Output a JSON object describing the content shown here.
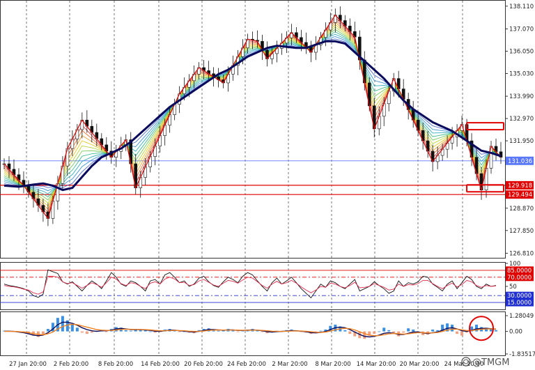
{
  "chart_data": [
    {
      "type": "candlestick",
      "title": "",
      "x": [
        "27 Jan 20:00",
        "2 Feb 20:00",
        "8 Feb 20:00",
        "14 Feb 20:00",
        "20 Feb 20:00",
        "24 Feb 20:00",
        "2 Mar 20:00",
        "8 Mar 20:00",
        "14 Mar 20:00",
        "20 Mar 20:00",
        "24 Mar 20:00"
      ],
      "y_ticks": [
        "138.110",
        "137.070",
        "136.050",
        "135.030",
        "133.990",
        "132.970",
        "131.950",
        "129.918",
        "129.494",
        "128.870",
        "127.850",
        "126.810"
      ],
      "ylim": [
        126.6,
        138.2
      ],
      "current_price": "131.036",
      "levels": [
        {
          "label": "129.918",
          "value": 129.918,
          "color": "#e00000"
        },
        {
          "label": "129.494",
          "value": 129.494,
          "color": "#e00000"
        },
        {
          "label": "131.036",
          "value": 131.036,
          "color": "#5a78ff"
        }
      ],
      "series": [
        {
          "name": "",
          "color": "#0a0a5c",
          "values": [
            [
              0,
              129.9
            ],
            [
              3,
              129.85
            ],
            [
              6,
              129.95
            ],
            [
              8,
              130.0
            ],
            [
              10,
              129.9
            ],
            [
              12,
              129.7
            ],
            [
              14,
              129.8
            ],
            [
              16,
              130.3
            ],
            [
              18,
              130.8
            ],
            [
              20,
              131.2
            ],
            [
              22,
              131.4
            ],
            [
              24,
              131.6
            ],
            [
              26,
              131.9
            ],
            [
              28,
              132.3
            ],
            [
              30,
              132.7
            ],
            [
              32,
              133.1
            ],
            [
              34,
              133.5
            ],
            [
              36,
              133.8
            ],
            [
              38,
              134.1
            ],
            [
              40,
              134.4
            ],
            [
              42,
              134.7
            ],
            [
              44,
              135.0
            ],
            [
              46,
              135.2
            ],
            [
              48,
              135.5
            ],
            [
              50,
              135.8
            ],
            [
              52,
              136.0
            ],
            [
              54,
              136.2
            ],
            [
              56,
              136.3
            ],
            [
              58,
              136.25
            ],
            [
              60,
              136.2
            ],
            [
              62,
              136.2
            ],
            [
              64,
              136.35
            ],
            [
              66,
              136.5
            ],
            [
              68,
              136.5
            ],
            [
              70,
              136.4
            ],
            [
              72,
              136.0
            ],
            [
              74,
              135.6
            ],
            [
              76,
              135.2
            ],
            [
              78,
              134.8
            ],
            [
              80,
              134.3
            ],
            [
              82,
              133.8
            ],
            [
              84,
              133.4
            ],
            [
              86,
              133.1
            ],
            [
              88,
              132.8
            ],
            [
              90,
              132.6
            ],
            [
              92,
              132.4
            ],
            [
              94,
              132.1
            ],
            [
              96,
              131.8
            ],
            [
              98,
              131.5
            ],
            [
              100,
              131.4
            ],
            [
              102,
              131.25
            ]
          ]
        }
      ],
      "zigzag": [
        [
          0,
          130.9
        ],
        [
          4,
          129.9
        ],
        [
          9,
          128.4
        ],
        [
          13,
          131.6
        ],
        [
          16,
          132.9
        ],
        [
          22,
          131.2
        ],
        [
          25,
          132.0
        ],
        [
          27,
          129.8
        ],
        [
          36,
          134.1
        ],
        [
          40,
          135.3
        ],
        [
          45,
          134.6
        ],
        [
          50,
          136.6
        ],
        [
          52,
          136.5
        ],
        [
          54,
          135.7
        ],
        [
          59,
          136.9
        ],
        [
          63,
          136.0
        ],
        [
          68,
          137.7
        ],
        [
          72,
          136.7
        ],
        [
          76,
          132.5
        ],
        [
          80,
          134.8
        ],
        [
          88,
          131.0
        ],
        [
          94,
          132.7
        ],
        [
          98,
          129.7
        ],
        [
          100,
          131.7
        ],
        [
          102,
          131.2
        ]
      ],
      "boxes": [
        {
          "value": 132.62,
          "color": "#e00000"
        },
        {
          "value": 129.78,
          "color": "#e00000"
        }
      ]
    },
    {
      "type": "line",
      "title": "",
      "ylim": [
        0,
        100
      ],
      "y_ticks": [
        "100",
        "85.0000",
        "70.0000",
        "50",
        "30.0000",
        "15.0000"
      ],
      "levels": [
        {
          "label": "85.0000",
          "value": 85,
          "color": "#e00000"
        },
        {
          "label": "70.0000",
          "value": 70,
          "color": "#e00000"
        },
        {
          "label": "30.0000",
          "value": 30,
          "color": "#2030d0"
        },
        {
          "label": "15.0000",
          "value": 15,
          "color": "#2030d0"
        }
      ],
      "series": [
        {
          "name": "",
          "color": "#111111",
          "values": [
            55,
            52,
            50,
            48,
            45,
            40,
            30,
            26,
            33,
            86,
            82,
            78,
            60,
            55,
            60,
            50,
            40,
            52,
            62,
            55,
            45,
            62,
            80,
            70,
            55,
            50,
            62,
            58,
            50,
            40,
            62,
            65,
            55,
            75,
            80,
            70,
            58,
            62,
            50,
            55,
            68,
            72,
            60,
            52,
            48,
            60,
            70,
            65,
            58,
            72,
            80,
            75,
            62,
            50,
            40,
            58,
            68,
            55,
            62,
            70,
            58,
            45,
            35,
            25,
            40,
            55,
            48,
            62,
            58,
            50,
            45,
            55,
            65,
            40,
            45,
            50,
            60,
            52,
            45,
            35,
            40,
            62,
            50,
            58,
            55,
            60,
            72,
            70,
            55,
            48,
            40,
            55,
            62,
            45,
            58,
            72,
            65,
            50,
            45,
            55,
            50,
            52
          ]
        },
        {
          "name": "",
          "color": "#e03050",
          "values": [
            52,
            50,
            49,
            47,
            44,
            42,
            36,
            33,
            38,
            72,
            72,
            70,
            60,
            56,
            58,
            52,
            46,
            52,
            58,
            54,
            48,
            58,
            70,
            66,
            56,
            52,
            58,
            56,
            50,
            45,
            57,
            60,
            55,
            66,
            70,
            66,
            58,
            59,
            52,
            54,
            62,
            65,
            59,
            53,
            50,
            57,
            63,
            61,
            57,
            64,
            70,
            68,
            60,
            52,
            46,
            55,
            61,
            55,
            58,
            63,
            57,
            49,
            42,
            36,
            42,
            50,
            48,
            57,
            55,
            50,
            47,
            52,
            59,
            47,
            48,
            50,
            56,
            52,
            48,
            42,
            44,
            55,
            50,
            54,
            53,
            56,
            63,
            63,
            56,
            50,
            45,
            52,
            57,
            49,
            54,
            63,
            60,
            52,
            48,
            52,
            50,
            51
          ]
        }
      ]
    },
    {
      "type": "bar",
      "title": "",
      "ylim": [
        -1.83517,
        1.28049
      ],
      "y_ticks": [
        "1.28049",
        "0.00",
        "-1.83517"
      ],
      "bars_positive_color": "#3b8fe0",
      "bars_negative_color": "#f0a080",
      "values": [
        0.05,
        0.04,
        0.03,
        -0.05,
        -0.1,
        -0.2,
        -0.35,
        -0.45,
        -0.3,
        0.2,
        0.7,
        1.1,
        1.25,
        0.9,
        0.6,
        0.3,
        -0.1,
        -0.2,
        -0.1,
        0.05,
        0.1,
        -0.05,
        0.2,
        0.35,
        0.3,
        0.1,
        0.05,
        0.2,
        0.15,
        0.1,
        0.0,
        -0.1,
        -0.05,
        0.15,
        0.2,
        0.1,
        -0.05,
        0.0,
        -0.1,
        -0.15,
        0.1,
        0.2,
        0.25,
        0.15,
        0.05,
        0.1,
        0.2,
        0.15,
        -0.05,
        0.1,
        0.15,
        0.2,
        0.1,
        -0.05,
        -0.15,
        -0.05,
        0.05,
        0.0,
        0.1,
        0.15,
        0.05,
        -0.05,
        -0.1,
        -0.2,
        -0.15,
        0.05,
        0.15,
        0.45,
        0.55,
        0.4,
        0.1,
        -0.2,
        -0.4,
        -0.55,
        -0.6,
        -0.35,
        -0.2,
        0.0,
        0.3,
        0.1,
        -0.2,
        -0.4,
        -0.1,
        0.25,
        0.15,
        -0.1,
        -0.3,
        -0.25,
        0.15,
        0.1,
        0.55,
        0.65,
        0.55,
        -0.2,
        -0.35,
        -0.1,
        0.4,
        0.55,
        0.35,
        0.3,
        0.2,
        0.1
      ],
      "series": [
        {
          "name": "",
          "color": "#0a0a5c",
          "values": [
            0.02,
            0.02,
            0.0,
            -0.05,
            -0.1,
            -0.2,
            -0.3,
            -0.35,
            -0.3,
            -0.1,
            0.2,
            0.55,
            0.75,
            0.75,
            0.65,
            0.5,
            0.3,
            0.15,
            0.05,
            0.0,
            0.05,
            0.05,
            0.1,
            0.2,
            0.25,
            0.2,
            0.15,
            0.15,
            0.15,
            0.12,
            0.08,
            0.02,
            0.0,
            0.05,
            0.1,
            0.1,
            0.05,
            0.02,
            -0.02,
            -0.05,
            0.0,
            0.08,
            0.15,
            0.15,
            0.12,
            0.1,
            0.12,
            0.12,
            0.08,
            0.08,
            0.1,
            0.12,
            0.1,
            0.05,
            -0.02,
            -0.05,
            -0.02,
            0.0,
            0.03,
            0.06,
            0.05,
            0.02,
            -0.03,
            -0.1,
            -0.12,
            -0.08,
            0.0,
            0.15,
            0.3,
            0.35,
            0.3,
            0.15,
            -0.05,
            -0.25,
            -0.4,
            -0.45,
            -0.4,
            -0.3,
            -0.15,
            -0.1,
            -0.15,
            -0.25,
            -0.25,
            -0.15,
            -0.05,
            -0.05,
            -0.12,
            -0.18,
            -0.1,
            -0.05,
            0.1,
            0.25,
            0.3,
            0.2,
            0.05,
            0.0,
            0.1,
            0.2,
            0.25,
            0.25,
            0.22,
            0.18
          ]
        },
        {
          "name": "",
          "color": "#f08020",
          "values": [
            0.0,
            0.0,
            0.0,
            -0.02,
            -0.05,
            -0.1,
            -0.18,
            -0.25,
            -0.27,
            -0.2,
            -0.05,
            0.2,
            0.4,
            0.52,
            0.58,
            0.55,
            0.45,
            0.35,
            0.25,
            0.15,
            0.1,
            0.08,
            0.08,
            0.12,
            0.16,
            0.18,
            0.17,
            0.16,
            0.15,
            0.14,
            0.12,
            0.08,
            0.05,
            0.05,
            0.07,
            0.08,
            0.07,
            0.05,
            0.02,
            0.0,
            0.0,
            0.03,
            0.08,
            0.11,
            0.12,
            0.11,
            0.11,
            0.11,
            0.1,
            0.09,
            0.09,
            0.1,
            0.1,
            0.08,
            0.05,
            0.02,
            0.0,
            0.0,
            0.01,
            0.03,
            0.04,
            0.03,
            0.01,
            -0.03,
            -0.07,
            -0.08,
            -0.05,
            0.03,
            0.13,
            0.21,
            0.25,
            0.22,
            0.12,
            -0.03,
            -0.18,
            -0.3,
            -0.35,
            -0.34,
            -0.27,
            -0.2,
            -0.17,
            -0.2,
            -0.22,
            -0.2,
            -0.14,
            -0.1,
            -0.1,
            -0.13,
            -0.12,
            -0.09,
            0.0,
            0.1,
            0.18,
            0.19,
            0.13,
            0.07,
            0.08,
            0.12,
            0.17,
            0.2,
            0.21,
            0.2
          ]
        }
      ]
    }
  ],
  "watermark": {
    "text": "@TMGM",
    "icon": "swirl-logo-icon"
  }
}
